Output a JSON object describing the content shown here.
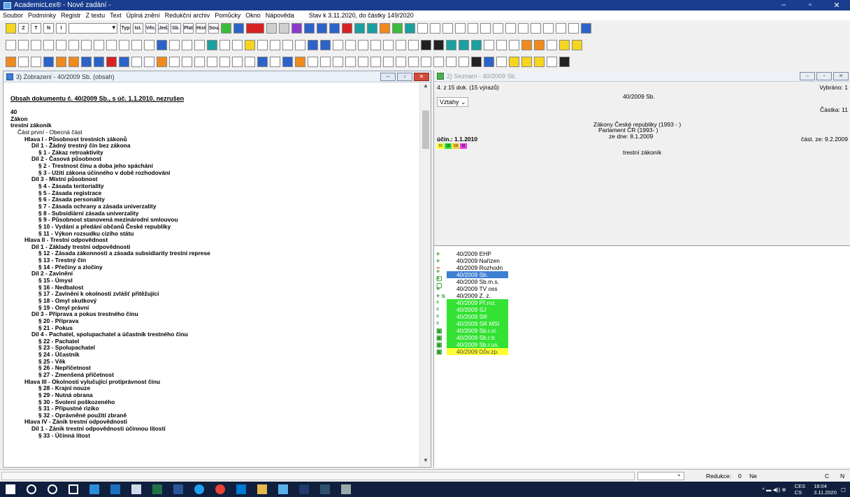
{
  "window": {
    "title": "AcademicLex® - Nové zadání -",
    "min": "–",
    "max": "▫",
    "close": "✕"
  },
  "menu": {
    "items": [
      "Soubor",
      "Podmínky",
      "Registr",
      "Z textu",
      "Text",
      "Úplná znění",
      "Redukční archiv",
      "Pomůcky",
      "Okno",
      "Nápověda"
    ],
    "status": "Stav k 3.11.2020, do částky 149/2020"
  },
  "toolbar1": {
    "labels": [
      "Z",
      "T",
      "N",
      "I",
      "Typ",
      "Ist.",
      "Věc.",
      "Jed.",
      "Sb.",
      "Plat",
      "Hist",
      "Sou."
    ]
  },
  "left_window": {
    "title": "3) Zobrazení - 40/2009 Sb. (obsah)",
    "header": "Obsah dokumentu č. 40/2009 Sb., s úč. 1.1.2010, nezrušen",
    "lines": [
      {
        "indent": 0,
        "bold": true,
        "text": "40"
      },
      {
        "indent": 0,
        "bold": true,
        "text": "Zákon"
      },
      {
        "indent": 0,
        "bold": true,
        "text": "trestní zákoník"
      },
      {
        "indent": 1,
        "bold": false,
        "text": "Část první - Obecná část"
      },
      {
        "indent": 2,
        "bold": false,
        "text": "Hlava I - Působnost trestních zákonů"
      },
      {
        "indent": 3,
        "bold": false,
        "text": "Díl 1 - Žádný trestný čin bez zákona"
      },
      {
        "indent": 4,
        "bold": false,
        "text": "§ 1 - Zákaz retroaktivity"
      },
      {
        "indent": 3,
        "bold": false,
        "text": "Díl 2 - Časová působnost"
      },
      {
        "indent": 4,
        "bold": false,
        "text": "§ 2 - Trestnost činu a doba jeho spáchání"
      },
      {
        "indent": 4,
        "bold": false,
        "text": "§ 3 - Užití zákona účinného v době rozhodování"
      },
      {
        "indent": 3,
        "bold": false,
        "text": "Díl 3 - Místní působnost"
      },
      {
        "indent": 4,
        "bold": false,
        "text": "§ 4 - Zásada teritoriality"
      },
      {
        "indent": 4,
        "bold": false,
        "text": "§ 5 - Zásada registrace"
      },
      {
        "indent": 4,
        "bold": false,
        "text": "§ 6 - Zásada personality"
      },
      {
        "indent": 4,
        "bold": false,
        "text": "§ 7 - Zásada ochrany a zásada univerzality"
      },
      {
        "indent": 4,
        "bold": false,
        "text": "§ 8 - Subsidiární zásada univerzality"
      },
      {
        "indent": 4,
        "bold": false,
        "text": "§ 9 - Působnost stanovená mezinárodní smlouvou"
      },
      {
        "indent": 4,
        "bold": false,
        "text": "§ 10 - Vydání a předání občanů České republiky"
      },
      {
        "indent": 4,
        "bold": false,
        "text": "§ 11 - Výkon rozsudku cizího státu"
      },
      {
        "indent": 2,
        "bold": false,
        "text": "Hlava II - Trestní odpovědnost"
      },
      {
        "indent": 3,
        "bold": false,
        "text": "Díl 1 - Základy trestní odpovědnosti"
      },
      {
        "indent": 4,
        "bold": false,
        "text": "§ 12 - Zásada zákonnosti a zásada subsidiarity trestní represe"
      },
      {
        "indent": 4,
        "bold": false,
        "text": "§ 13 - Trestný čin"
      },
      {
        "indent": 4,
        "bold": false,
        "text": "§ 14 - Přečiny a zločiny"
      },
      {
        "indent": 3,
        "bold": false,
        "text": "Díl 2 - Zavinění"
      },
      {
        "indent": 4,
        "bold": false,
        "text": "§ 15 - Úmysl"
      },
      {
        "indent": 4,
        "bold": false,
        "text": "§ 16 - Nedbalost"
      },
      {
        "indent": 4,
        "bold": false,
        "text": "§ 17 - Zavinění k okolnosti zvlášť přitěžující"
      },
      {
        "indent": 4,
        "bold": false,
        "text": "§ 18 - Omyl skutkový"
      },
      {
        "indent": 4,
        "bold": false,
        "text": "§ 19 - Omyl právní"
      },
      {
        "indent": 3,
        "bold": false,
        "text": "Díl 3 - Příprava a pokus trestného činu"
      },
      {
        "indent": 4,
        "bold": false,
        "text": "§ 20 - Příprava"
      },
      {
        "indent": 4,
        "bold": false,
        "text": "§ 21 - Pokus"
      },
      {
        "indent": 3,
        "bold": false,
        "text": "Díl 4 - Pachatel, spolupachatel a účastník trestného činu"
      },
      {
        "indent": 4,
        "bold": false,
        "text": "§ 22 - Pachatel"
      },
      {
        "indent": 4,
        "bold": false,
        "text": "§ 23 - Spolupachatel"
      },
      {
        "indent": 4,
        "bold": false,
        "text": "§ 24 - Účastník"
      },
      {
        "indent": 4,
        "bold": false,
        "text": "§ 25 - Věk"
      },
      {
        "indent": 4,
        "bold": false,
        "text": "§ 26 - Nepříčetnost"
      },
      {
        "indent": 4,
        "bold": false,
        "text": "§ 27 - Zmenšená příčetnost"
      },
      {
        "indent": 2,
        "bold": false,
        "text": "Hlava III - Okolnosti vylučující protiprávnost činu"
      },
      {
        "indent": 4,
        "bold": false,
        "text": "§ 28 - Krajní nouze"
      },
      {
        "indent": 4,
        "bold": false,
        "text": "§ 29 - Nutná obrana"
      },
      {
        "indent": 4,
        "bold": false,
        "text": "§ 30 - Svolení poškozeného"
      },
      {
        "indent": 4,
        "bold": false,
        "text": "§ 31 - Přípustné riziko"
      },
      {
        "indent": 4,
        "bold": false,
        "text": "§ 32 - Oprávněné použití zbraně"
      },
      {
        "indent": 2,
        "bold": false,
        "text": "Hlava IV - Zánik trestní odpovědnosti"
      },
      {
        "indent": 3,
        "bold": false,
        "text": "Díl 1 - Zánik trestní odpovědnosti účinnou lítostí"
      },
      {
        "indent": 4,
        "bold": false,
        "text": "§ 33 - Účinná lítost"
      }
    ]
  },
  "right_window": {
    "title": "2) Seznam - 40/2009 Sb.",
    "count": "4. z 15 dok. (15 výrazů)",
    "relations": "Vztahy",
    "selected": "Vybráno: 1",
    "doc_number": "40/2009 Sb.",
    "castka": "Částka: 11",
    "collection": "Zákony České republiky (1993 -   )",
    "parliament": "Parlament ČR (1993-   )",
    "date": "ze dne: 8.1.2009",
    "ucin": "účin.: 1.1.2010",
    "cast_ze": "část. ze: 9.2.2009",
    "doc_title": "trestní zákoník",
    "chips": [
      "15",
      "18",
      "19",
      "M"
    ],
    "list": [
      {
        "mark": "+",
        "label": "40/2009 EHP",
        "style": "plain"
      },
      {
        "mark": "+",
        "label": "40/2009 Nařízen",
        "style": "plain"
      },
      {
        "mark": "−",
        "label": "40/2009 Rozhodn",
        "style": "plain"
      },
      {
        "mark": "+ ▢",
        "label": "40/2009 Sb.",
        "style": "sel"
      },
      {
        "mark": "+ ▢",
        "label": "40/2009 Sb.m.s.",
        "style": "plain"
      },
      {
        "mark": "+",
        "label": "40/2009 TV oss",
        "style": "plain"
      },
      {
        "mark": "+ s",
        "label": "40/2009 Z. z.",
        "style": "plain"
      },
      {
        "mark": "a",
        "label": "40/2009 Př.roz.",
        "style": "green"
      },
      {
        "mark": "a",
        "label": "40/2009 SJ",
        "style": "green"
      },
      {
        "mark": "a",
        "label": "40/2009 SR",
        "style": "green"
      },
      {
        "mark": "a",
        "label": "40/2009 SR MSI",
        "style": "green"
      },
      {
        "mark": "▣",
        "label": "40/2009 Sb.r.ci.",
        "style": "green"
      },
      {
        "mark": "▣",
        "label": "40/2009 Sb.r.tr.",
        "style": "green"
      },
      {
        "mark": "▣",
        "label": "40/2009 Sb.r.us.",
        "style": "green"
      },
      {
        "mark": "▣",
        "label": "40/2009 Dův.zp.",
        "style": "yellow"
      }
    ]
  },
  "statusbar": {
    "redukce_label": "Redukce:",
    "redukce_value": "0",
    "ne": "Ne",
    "c": "C",
    "n": "N"
  },
  "taskbar": {
    "lang": "CES",
    "time": "18:04",
    "date": "3.11.2020",
    "lang2": "CS"
  }
}
